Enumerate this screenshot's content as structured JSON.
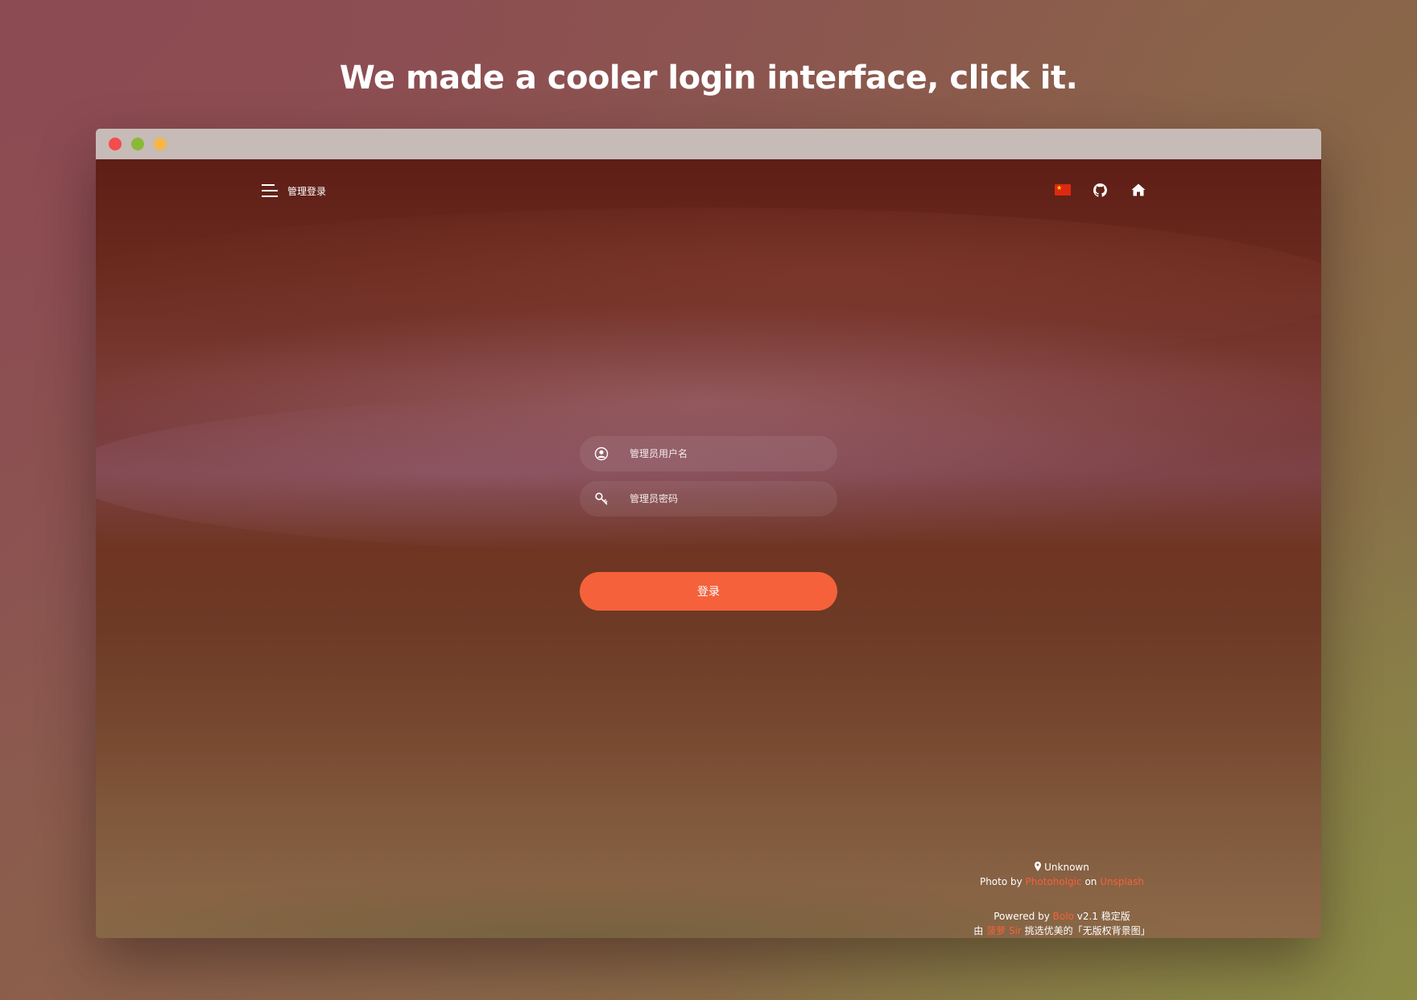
{
  "headline": "We made a cooler login interface, click it.",
  "colors": {
    "accent": "#f5613a",
    "titlebar": "#c7bbb8",
    "traffic_red": "#f44b4b",
    "traffic_green": "#8cb83a",
    "traffic_yellow": "#f4b748"
  },
  "window": {
    "traffic_lights": [
      "close",
      "minimize",
      "maximize"
    ]
  },
  "nav": {
    "title": "管理登录",
    "menu_icon": "hamburger-menu-icon",
    "right_icons": [
      "china-flag-icon",
      "github-icon",
      "home-icon"
    ]
  },
  "form": {
    "username_placeholder": "管理员用户名",
    "password_placeholder": "管理员密码",
    "username_icon": "user-circle-icon",
    "password_icon": "key-icon",
    "login_label": "登录"
  },
  "credits": {
    "location": "Unknown",
    "photo_by_prefix": "Photo by",
    "photographer": "Photoholgic",
    "on": "on",
    "source": "Unsplash",
    "powered_by_prefix": "Powered by",
    "powered_name": "Bolo",
    "version": "v2.1 稳定版",
    "curated_prefix": "由",
    "curator": "菠萝 Sir",
    "curated_suffix": "挑选优美的「无版权背景图」"
  }
}
